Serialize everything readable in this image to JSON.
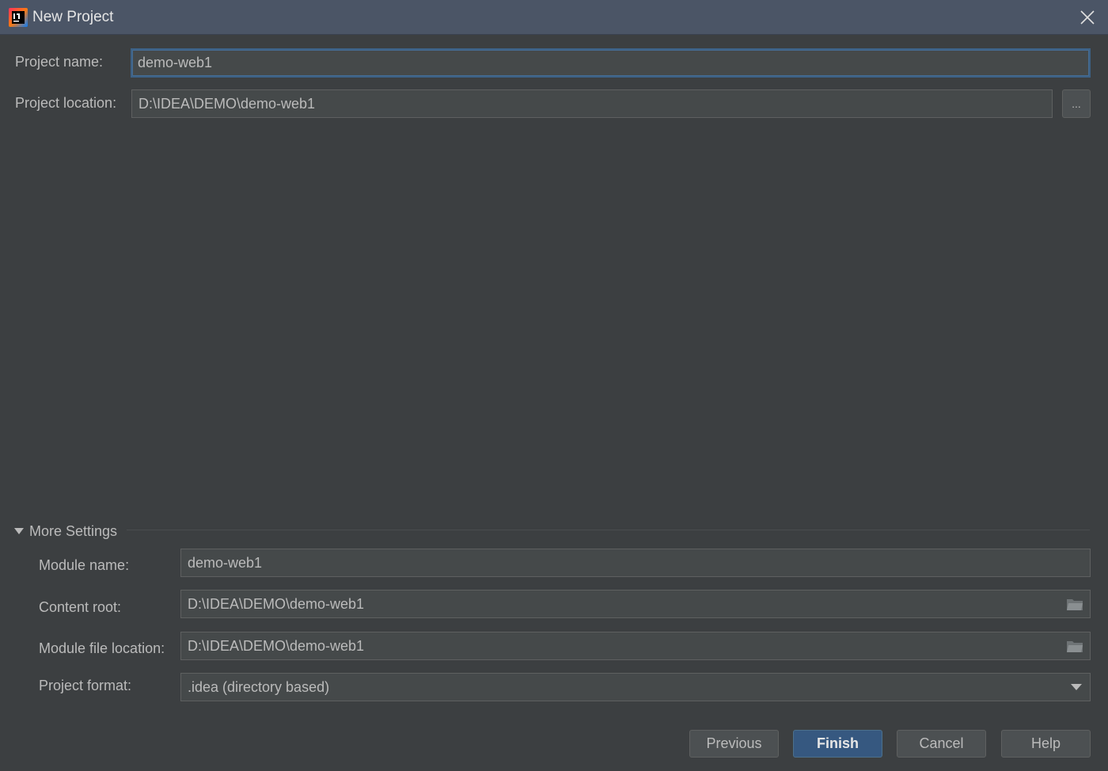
{
  "window": {
    "title": "New Project",
    "app_icon": "intellij-idea-icon"
  },
  "project": {
    "name_label": "Project name:",
    "name_value": "demo-web1",
    "location_label": "Project location:",
    "location_value": "D:\\IDEA\\DEMO\\demo-web1",
    "browse_label": "..."
  },
  "more_settings": {
    "label": "More Settings",
    "expanded": true,
    "module_name_label": "Module name:",
    "module_name_value": "demo-web1",
    "content_root_label": "Content root:",
    "content_root_value": "D:\\IDEA\\DEMO\\demo-web1",
    "module_file_label": "Module file location:",
    "module_file_value": "D:\\IDEA\\DEMO\\demo-web1",
    "format_label": "Project format:",
    "format_value": ".idea (directory based)"
  },
  "buttons": {
    "previous": "Previous",
    "finish": "Finish",
    "cancel": "Cancel",
    "help": "Help"
  },
  "colors": {
    "background": "#3c3f41",
    "titlebar": "#4b5566",
    "field": "#45494a",
    "primary_button": "#365880",
    "focus_border": "#3d6185"
  }
}
